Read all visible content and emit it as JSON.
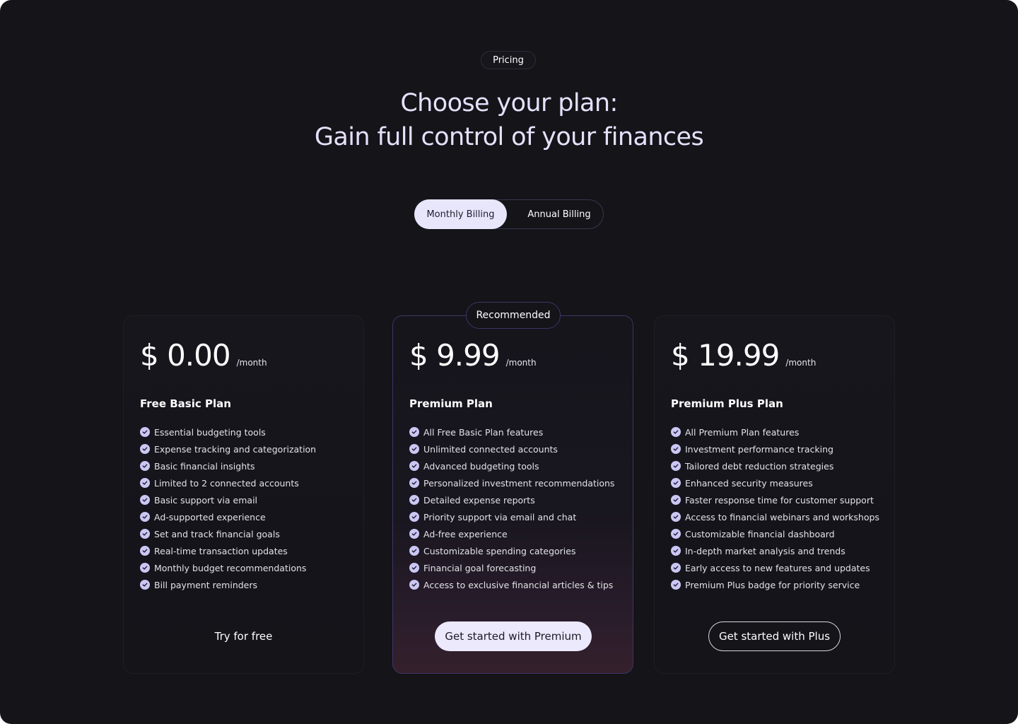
{
  "badge": "Pricing",
  "headline": {
    "line1": "Choose your plan:",
    "line2": "Gain full control of your finances"
  },
  "billing": {
    "monthly": "Monthly Billing",
    "annual": "Annual Billing",
    "selected": "monthly"
  },
  "plans": [
    {
      "price": "$ 0.00",
      "period": "/month",
      "name": "Free Basic Plan",
      "features": [
        "Essential budgeting tools",
        "Expense tracking and categorization",
        "Basic financial insights",
        "Limited to 2 connected accounts",
        "Basic support via email",
        "Ad-supported experience",
        "Set and track financial goals",
        "Real-time transaction updates",
        "Monthly budget recommendations",
        "Bill payment reminders"
      ],
      "cta": "Try for free"
    },
    {
      "badge": "Recommended",
      "price": "$ 9.99",
      "period": "/month",
      "name": "Premium Plan",
      "features": [
        "All Free Basic Plan features",
        "Unlimited connected accounts",
        "Advanced budgeting tools",
        "Personalized investment recommendations",
        "Detailed expense reports",
        "Priority support via email and chat",
        "Ad-free experience",
        "Customizable spending categories",
        "Financial goal forecasting",
        "Access to exclusive financial articles & tips"
      ],
      "cta": "Get started with Premium"
    },
    {
      "price": "$ 19.99",
      "period": "/month",
      "name": "Premium Plus Plan",
      "features": [
        "All Premium Plan features",
        "Investment performance tracking",
        "Tailored debt reduction strategies",
        "Enhanced security measures",
        "Faster response time for customer support",
        "Access to financial webinars and workshops",
        "Customizable financial dashboard",
        "In-depth market analysis and trends",
        "Early access to new features and updates",
        "Premium Plus badge for priority service"
      ],
      "cta": "Get started with Plus"
    }
  ],
  "colors": {
    "background": "#141419",
    "accent": "#e8e6fb",
    "check": "#cbc7f4",
    "featured_border": "#3e3466"
  }
}
